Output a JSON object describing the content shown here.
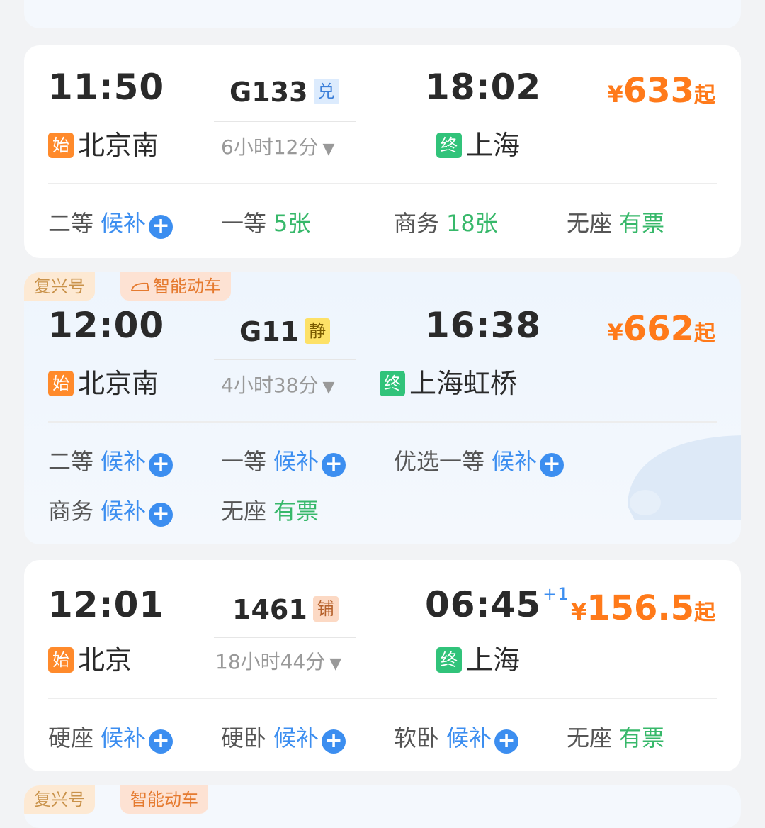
{
  "cards": [
    {
      "depart_time": "11:50",
      "train_no": "G133",
      "train_badge": "兑",
      "duration": "6小时12分",
      "arrive_time": "18:02",
      "arrive_day_offset": "",
      "price_symbol": "¥",
      "price": "633",
      "price_suffix": "起",
      "from_badge": "始",
      "from": "北京南",
      "to_badge": "终",
      "to": "上海",
      "seats": [
        {
          "name": "二等",
          "status": "候补",
          "plus": "+"
        },
        {
          "name": "一等",
          "status": "5张"
        },
        {
          "name": "商务",
          "status": "18张"
        },
        {
          "name": "无座",
          "status": "有票"
        }
      ]
    },
    {
      "tags": [
        "复兴号",
        "智能动车"
      ],
      "depart_time": "12:00",
      "train_no": "G11",
      "train_badge": "静",
      "duration": "4小时38分",
      "arrive_time": "16:38",
      "price_symbol": "¥",
      "price": "662",
      "price_suffix": "起",
      "from_badge": "始",
      "from": "北京南",
      "to_badge": "终",
      "to": "上海虹桥",
      "seats": [
        {
          "name": "二等",
          "status": "候补",
          "plus": "+"
        },
        {
          "name": "一等",
          "status": "候补",
          "plus": "+"
        },
        {
          "name": "优选一等",
          "status": "候补",
          "plus": "+"
        },
        {
          "name": "商务",
          "status": "候补",
          "plus": "+"
        },
        {
          "name": "无座",
          "status": "有票"
        }
      ]
    },
    {
      "depart_time": "12:01",
      "train_no": "1461",
      "train_badge": "铺",
      "duration": "18小时44分",
      "arrive_time": "06:45",
      "arrive_day_offset": "+1",
      "price_symbol": "¥",
      "price": "156.5",
      "price_suffix": "起",
      "from_badge": "始",
      "from": "北京",
      "to_badge": "终",
      "to": "上海",
      "seats": [
        {
          "name": "硬座",
          "status": "候补",
          "plus": "+"
        },
        {
          "name": "硬卧",
          "status": "候补",
          "plus": "+"
        },
        {
          "name": "软卧",
          "status": "候补",
          "plus": "+"
        },
        {
          "name": "无座",
          "status": "有票"
        }
      ]
    }
  ],
  "colors": {
    "price": "#ff7a1a",
    "available": "#37b86a",
    "waitlist": "#3c8ef0",
    "start_badge": "#ff8a2b",
    "end_badge": "#31c37a"
  },
  "icons": [
    "plus-circle-icon",
    "chevron-down-icon",
    "train-icon"
  ]
}
